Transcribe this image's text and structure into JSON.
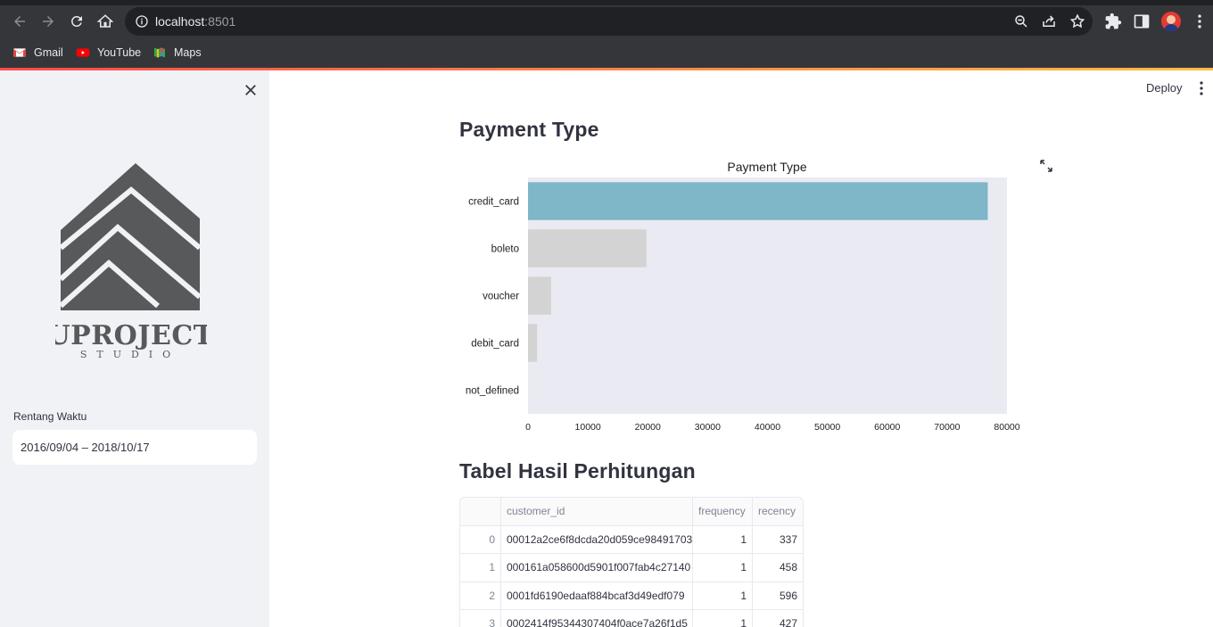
{
  "browser": {
    "url_host": "localhost",
    "url_port": ":8501",
    "bookmarks": [
      {
        "label": "Gmail",
        "icon": "gmail-icon"
      },
      {
        "label": "YouTube",
        "icon": "youtube-icon"
      },
      {
        "label": "Maps",
        "icon": "maps-icon"
      }
    ]
  },
  "app": {
    "deploy_label": "Deploy"
  },
  "sidebar": {
    "logo_text": "UPROJECT",
    "logo_subtext": "STUDIO",
    "date_label": "Rentang Waktu",
    "date_value": "2016/09/04 – 2018/10/17"
  },
  "main": {
    "section1_title": "Payment Type",
    "section2_title": "Tabel Hasil Perhitungan"
  },
  "chart_data": {
    "type": "bar",
    "orientation": "horizontal",
    "title": "Payment Type",
    "xlabel": "",
    "ylabel": "",
    "categories": [
      "credit_card",
      "boleto",
      "voucher",
      "debit_card",
      "not_defined"
    ],
    "values": [
      76795,
      19784,
      3866,
      1529,
      3
    ],
    "xlim": [
      0,
      80000
    ],
    "xticks": [
      0,
      10000,
      20000,
      30000,
      40000,
      50000,
      60000,
      70000,
      80000
    ],
    "colors": [
      "#7fb6c8",
      "#d3d3d3",
      "#d3d3d3",
      "#d3d3d3",
      "#d3d3d3"
    ],
    "background": "#eaeaf2",
    "grid": false
  },
  "table": {
    "columns": [
      "",
      "customer_id",
      "frequency",
      "recency"
    ],
    "rows": [
      {
        "index": "0",
        "customer_id": "00012a2ce6f8dcda20d059ce98491703",
        "frequency": "1",
        "recency": "337"
      },
      {
        "index": "1",
        "customer_id": "000161a058600d5901f007fab4c27140",
        "frequency": "1",
        "recency": "458"
      },
      {
        "index": "2",
        "customer_id": "0001fd6190edaaf884bcaf3d49edf079",
        "frequency": "1",
        "recency": "596"
      },
      {
        "index": "3",
        "customer_id": "0002414f95344307404f0ace7a26f1d5",
        "frequency": "1",
        "recency": "427"
      }
    ]
  }
}
